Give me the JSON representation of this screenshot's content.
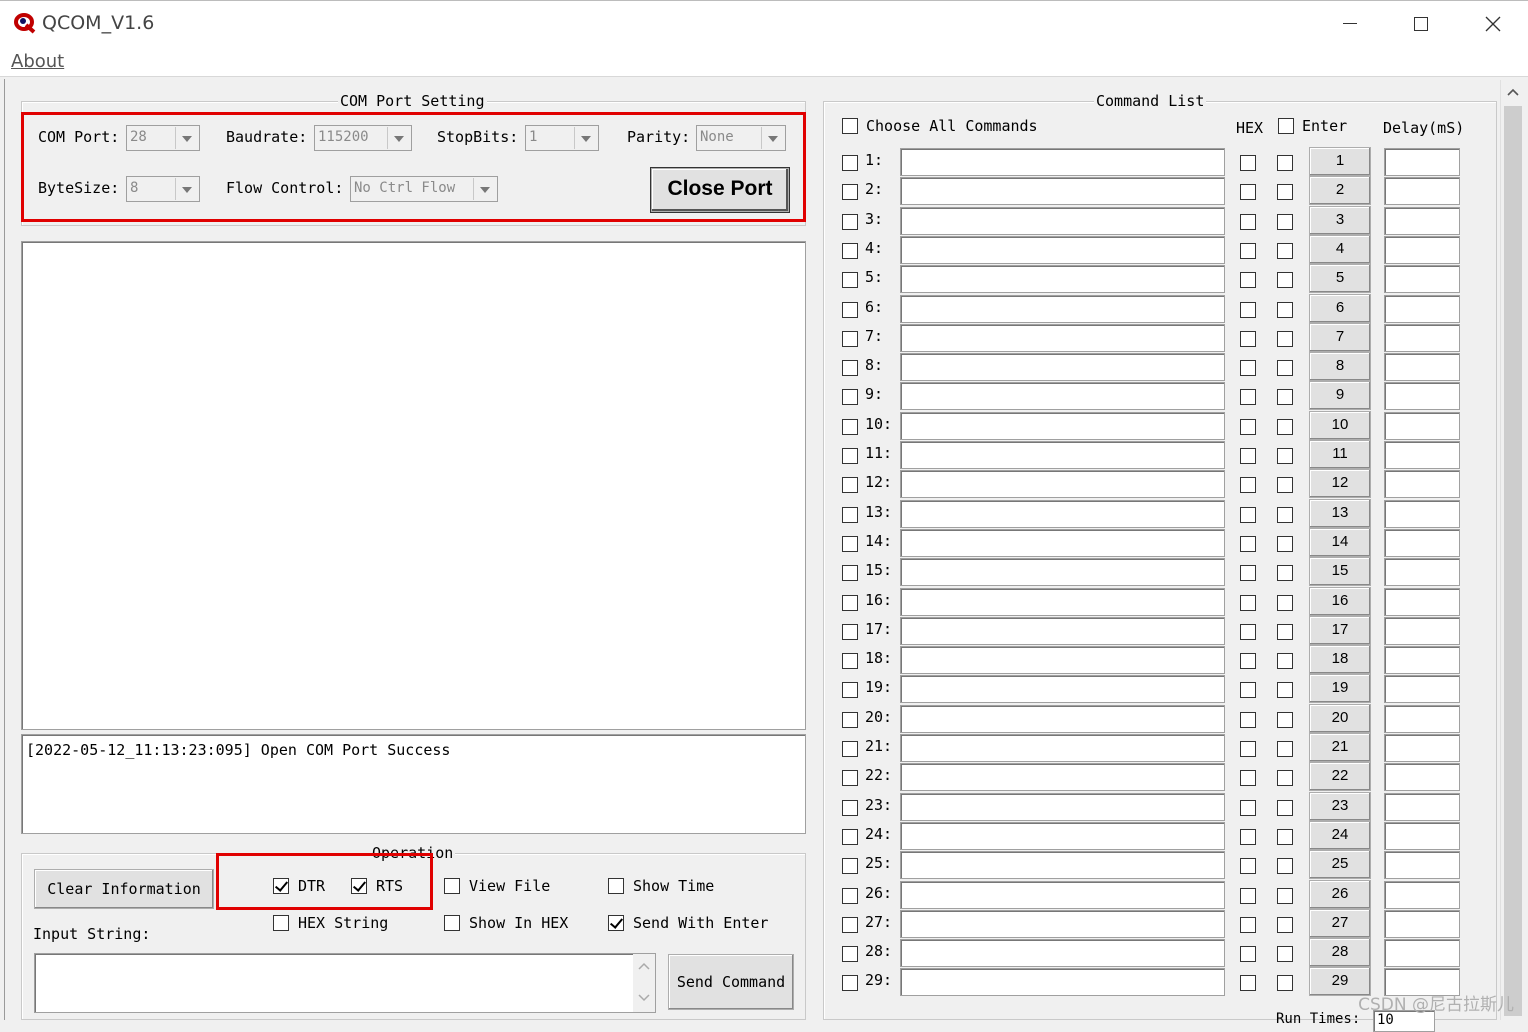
{
  "window": {
    "title": "QCOM_V1.6",
    "menu": [
      "About"
    ]
  },
  "port_setting": {
    "group_title": "COM Port Setting",
    "com_port_label": "COM Port:",
    "com_port_value": "28",
    "baudrate_label": "Baudrate:",
    "baudrate_value": "115200",
    "stopbits_label": "StopBits:",
    "stopbits_value": "1",
    "parity_label": "Parity:",
    "parity_value": "None",
    "bytesize_label": "ByteSize:",
    "bytesize_value": "8",
    "flow_label": "Flow Control:",
    "flow_value": "No Ctrl Flow",
    "close_port_label": "Close Port"
  },
  "info_log": "[2022-05-12_11:13:23:095] Open COM Port Success",
  "operation": {
    "group_title": "Operation",
    "clear_label": "Clear Information",
    "dtr_label": "DTR",
    "dtr_checked": true,
    "rts_label": "RTS",
    "rts_checked": true,
    "view_file_label": "View File",
    "show_time_label": "Show Time",
    "hex_string_label": "HEX String",
    "show_in_hex_label": "Show In HEX",
    "send_with_enter_label": "Send With Enter",
    "send_with_enter_checked": true,
    "input_string_label": "Input String:",
    "send_command_label": "Send Command"
  },
  "command_list": {
    "group_title": "Command List",
    "choose_all_label": "Choose All Commands",
    "hex_header": "HEX",
    "enter_header": "Enter",
    "delay_header": "Delay(mS)",
    "rows": [
      "1",
      "2",
      "3",
      "4",
      "5",
      "6",
      "7",
      "8",
      "9",
      "10",
      "11",
      "12",
      "13",
      "14",
      "15",
      "16",
      "17",
      "18",
      "19",
      "20",
      "21",
      "22",
      "23",
      "24",
      "25",
      "26",
      "27",
      "28",
      "29"
    ],
    "run_times_label": "Run Times:",
    "run_times_value": "10"
  },
  "watermark": "CSDN @尼古拉斯儿",
  "colors": {
    "highlight": "#e00000",
    "window_bg": "#f0f0f0"
  }
}
